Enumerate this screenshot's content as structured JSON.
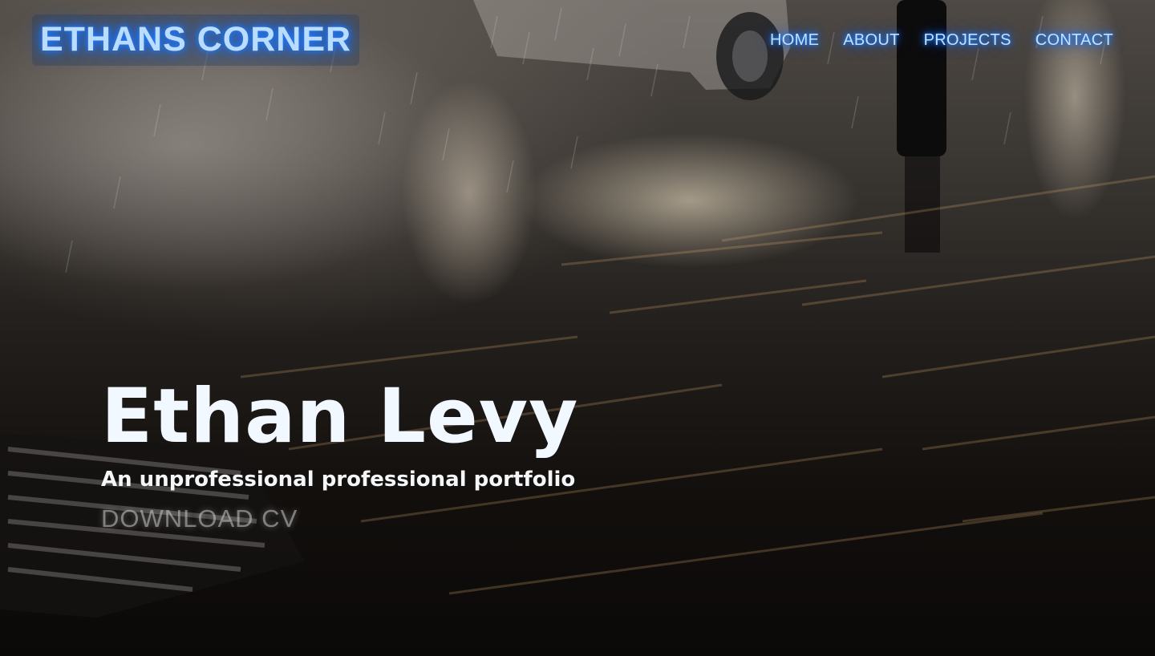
{
  "header": {
    "logo_text": "ETHANS CORNER",
    "nav": [
      {
        "label": "HOME"
      },
      {
        "label": "ABOUT"
      },
      {
        "label": "PROJECTS"
      },
      {
        "label": "CONTACT"
      }
    ]
  },
  "hero": {
    "name": "Ethan Levy",
    "tagline": "An unprofessional professional portfolio",
    "cta_label": "DOWNLOAD CV"
  },
  "theme": {
    "neon_accent": "#1e7bff",
    "nav_text": "#bfe0ff",
    "hero_text": "#f2f8ff"
  }
}
